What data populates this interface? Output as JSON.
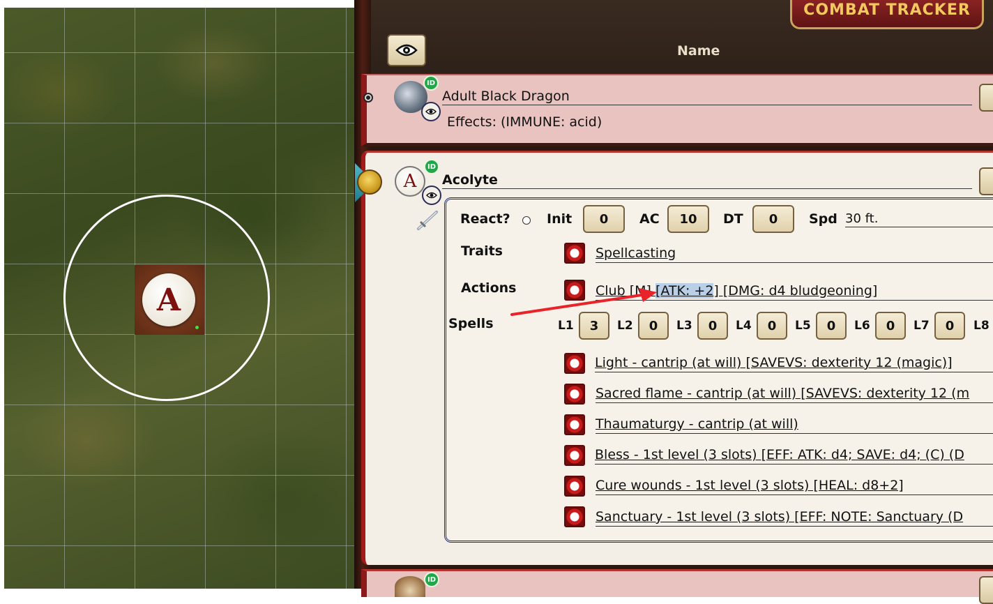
{
  "tracker": {
    "title": "COMBAT TRACKER",
    "name_column": "Name"
  },
  "map": {
    "token_letter": "A"
  },
  "combatants": [
    {
      "name": "Adult Black Dragon",
      "id_badge": "ID",
      "effects": "Effects: (IMMUNE: acid)"
    },
    {
      "name": "Acolyte",
      "id_badge": "ID",
      "token_letter": "A",
      "react_label": "React?",
      "init_label": "Init",
      "init": "0",
      "ac_label": "AC",
      "ac": "10",
      "dt_label": "DT",
      "dt": "0",
      "spd_label": "Spd",
      "spd": "30 ft.",
      "traits_label": "Traits",
      "traits": [
        "Spellcasting"
      ],
      "actions_label": "Actions",
      "action": {
        "prefix": "Club [M] ",
        "highlight": "[ATK: +2",
        "suffix": "] [DMG: d4 bludgeoning]"
      },
      "spells_label": "Spells",
      "slots": [
        {
          "label": "L1",
          "value": "3"
        },
        {
          "label": "L2",
          "value": "0"
        },
        {
          "label": "L3",
          "value": "0"
        },
        {
          "label": "L4",
          "value": "0"
        },
        {
          "label": "L5",
          "value": "0"
        },
        {
          "label": "L6",
          "value": "0"
        },
        {
          "label": "L7",
          "value": "0"
        },
        {
          "label": "L8",
          "value": ""
        }
      ],
      "spells": [
        "Light - cantrip (at will) [SAVEVS: dexterity 12 (magic)]",
        "Sacred flame - cantrip (at will) [SAVEVS: dexterity 12 (m",
        "Thaumaturgy - cantrip (at will)",
        "Bless - 1st level (3 slots) [EFF: ATK: d4; SAVE: d4; (C) (D",
        "Cure wounds - 1st level (3 slots) [HEAL: d8+2]",
        "Sanctuary - 1st level (3 slots) [EFF: NOTE: Sanctuary (D"
      ]
    },
    {
      "id_badge": "ID"
    }
  ],
  "colors": {
    "hostile_row": "#e9c3c0",
    "active_row": "#f4efe6",
    "accent_red": "#a11b1b",
    "title_gold": "#f1c95e",
    "annotation_arrow": "#e8232a",
    "selection": "#b9cfe8"
  }
}
